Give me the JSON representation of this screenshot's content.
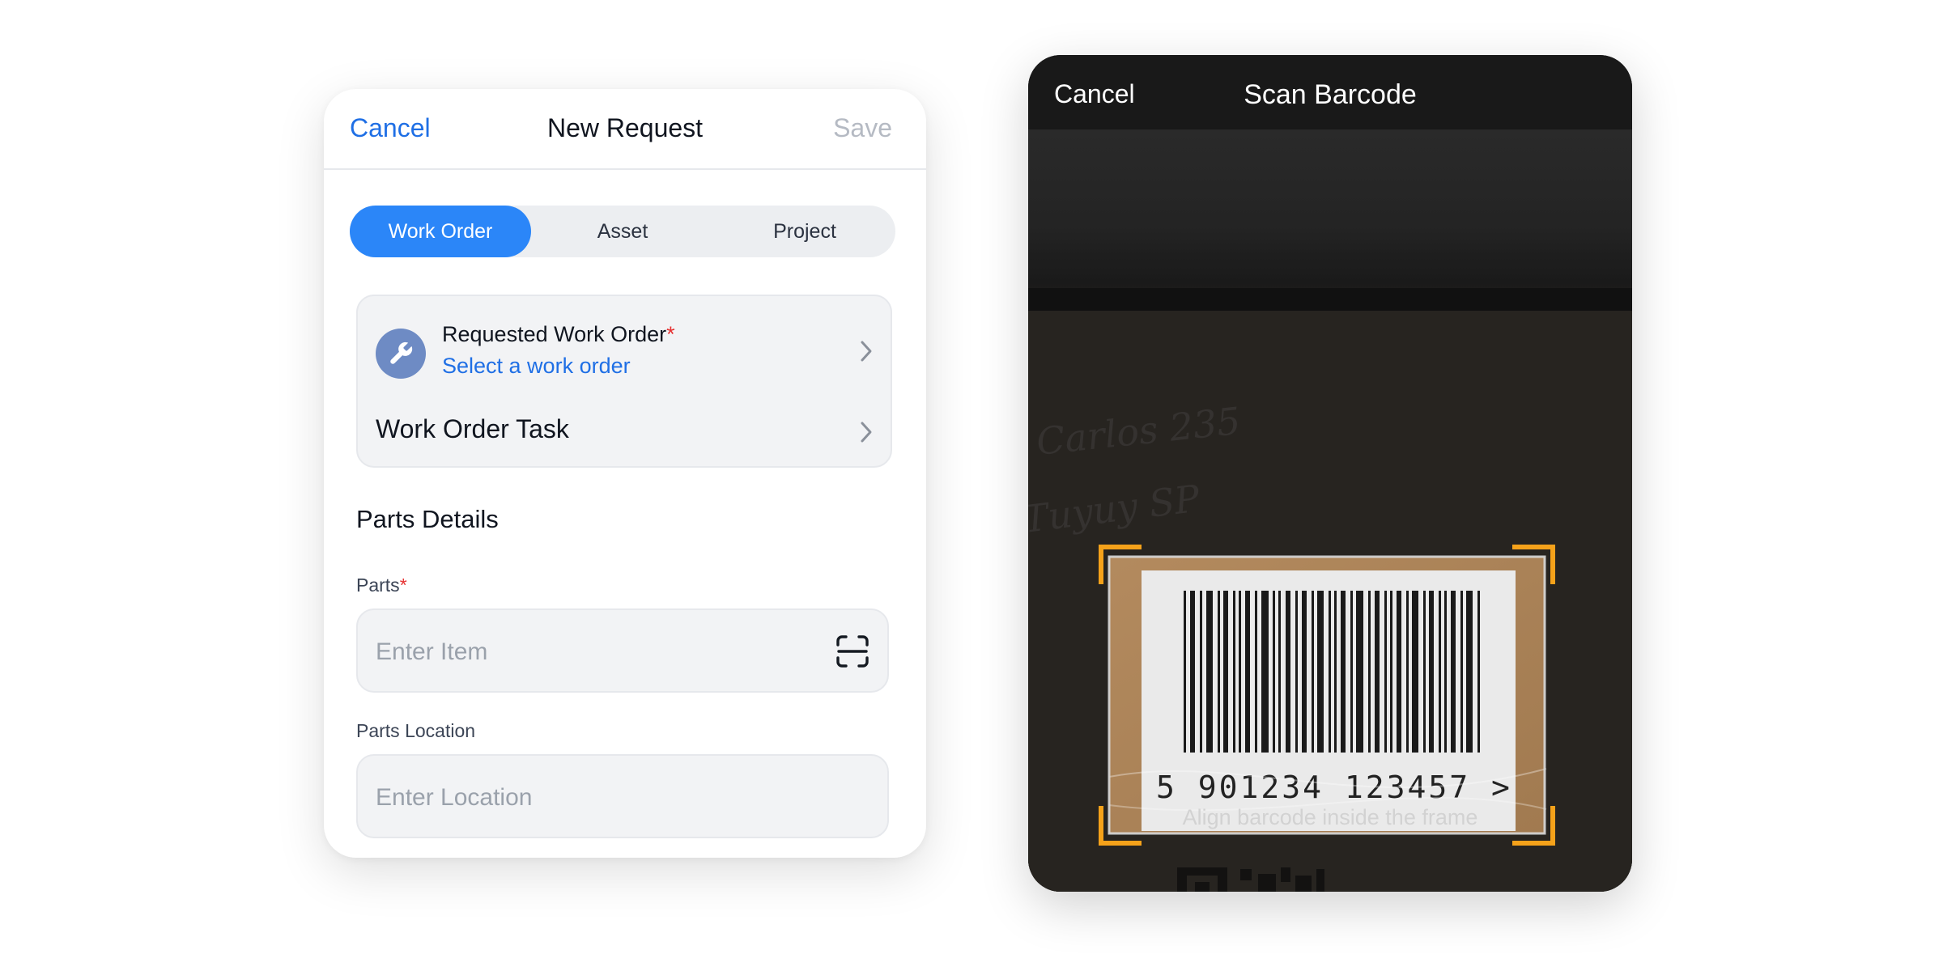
{
  "new_request": {
    "nav": {
      "cancel": "Cancel",
      "title": "New Request",
      "save": "Save"
    },
    "tabs": [
      {
        "label": "Work Order",
        "selected": true
      },
      {
        "label": "Asset",
        "selected": false
      },
      {
        "label": "Project",
        "selected": false
      }
    ],
    "work_order": {
      "label": "Requested Work Order",
      "required_mark": "*",
      "value_placeholder": "Select a work order",
      "task_label": "Work Order Task",
      "icon": "wrench-icon"
    },
    "parts_details": {
      "title": "Parts Details",
      "parts": {
        "label": "Parts",
        "required_mark": "*",
        "placeholder": "Enter Item",
        "icon": "scan-icon"
      },
      "location": {
        "label": "Parts Location",
        "placeholder": "Enter Location"
      }
    }
  },
  "scan_barcode": {
    "cancel": "Cancel",
    "title": "Scan Barcode",
    "barcode_number": "5  901234  123457 >",
    "handwriting": [
      "Carlos 235",
      "Tuyuy SP"
    ],
    "hint": "Align barcode inside the frame"
  },
  "colors": {
    "accent": "#1f6fe5",
    "tab_selected": "#2b86f8",
    "required": "#e63030",
    "frame_corners": "#f5a21a",
    "phone_header": "#191919"
  }
}
